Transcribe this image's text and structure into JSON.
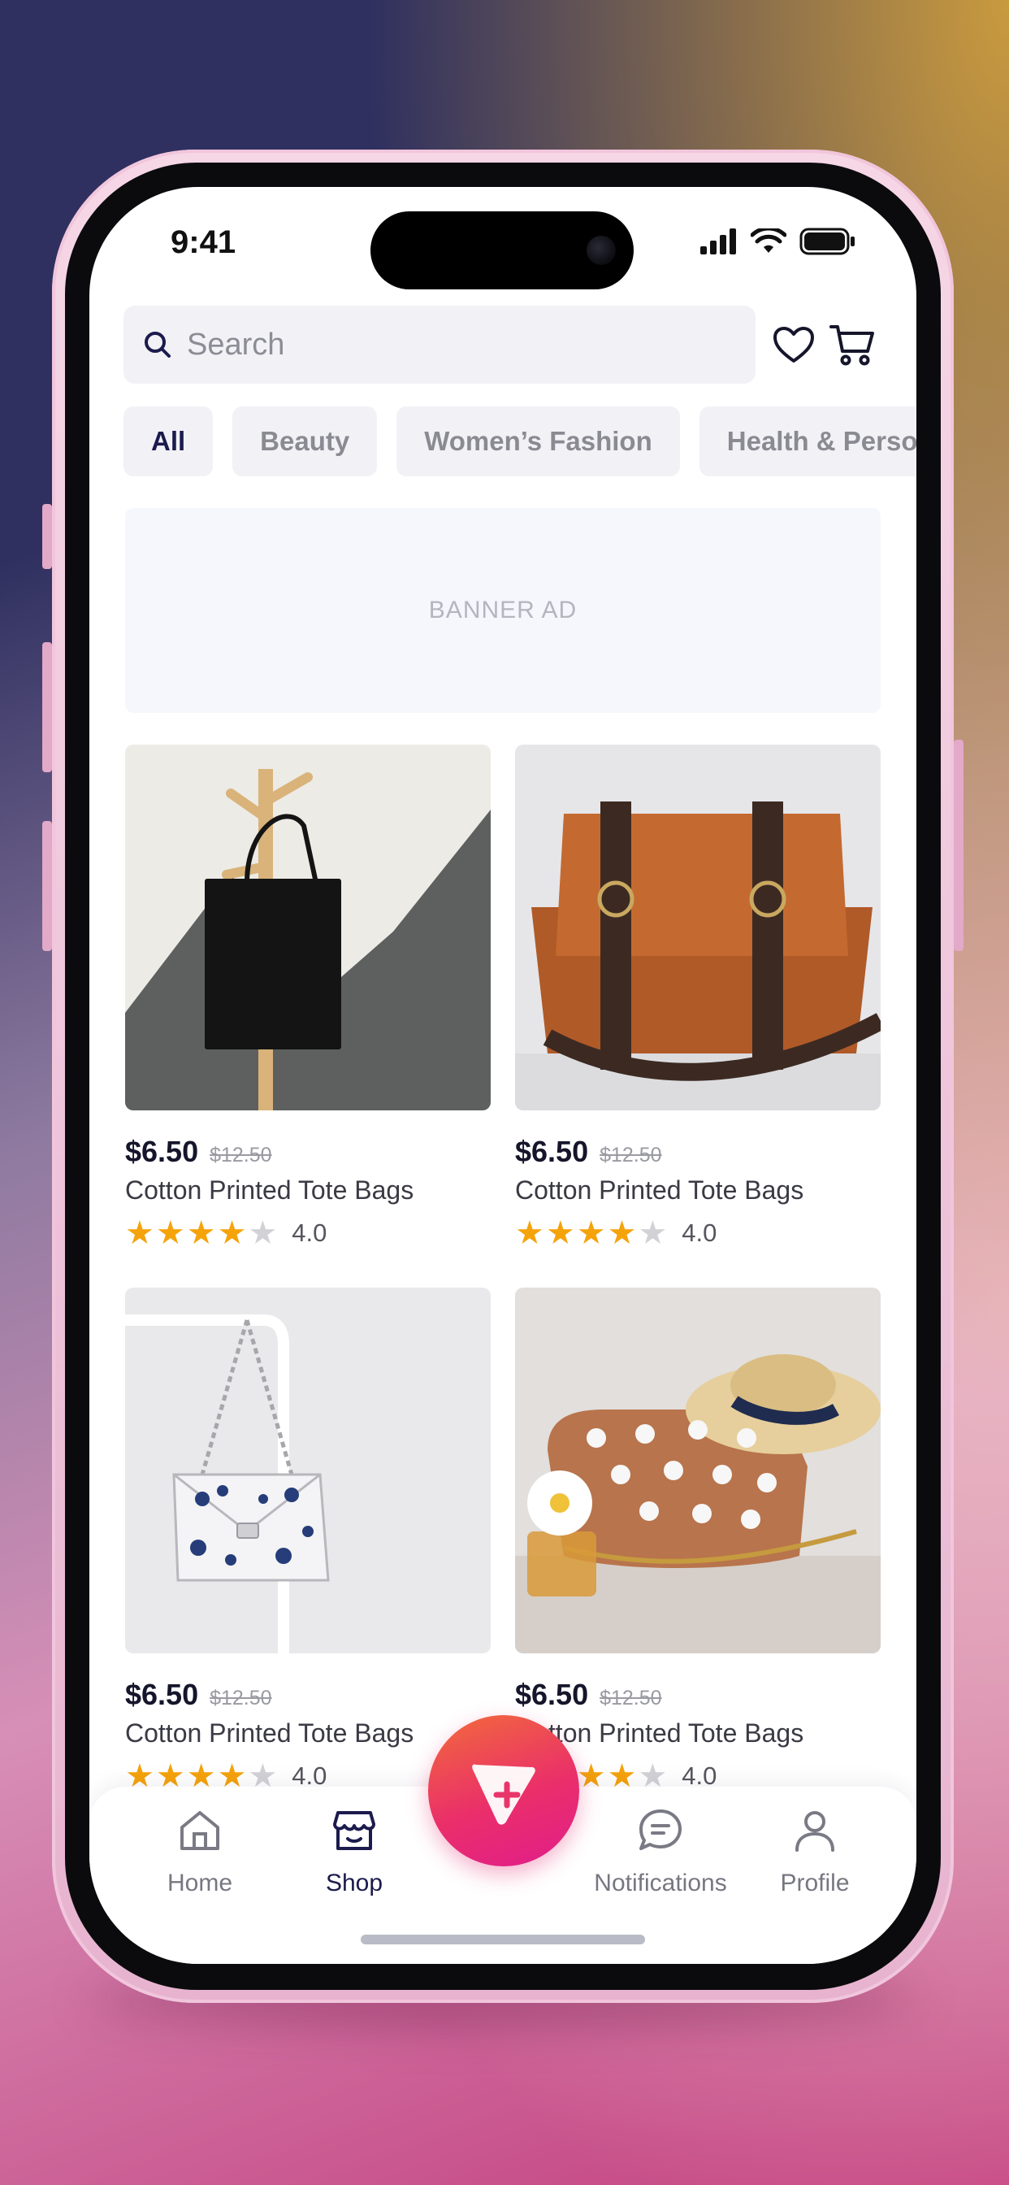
{
  "status_bar": {
    "time": "9:41"
  },
  "header": {
    "search_placeholder": "Search"
  },
  "categories": [
    {
      "label": "All",
      "active": true
    },
    {
      "label": "Beauty",
      "active": false
    },
    {
      "label": "Women’s Fashion",
      "active": false
    },
    {
      "label": "Health & Personal",
      "active": false
    }
  ],
  "banner": {
    "label": "BANNER AD"
  },
  "products": [
    {
      "price": "$6.50",
      "old_price": "$12.50",
      "title": "Cotton Printed Tote Bags",
      "rating": 4,
      "rating_label": "4.0",
      "image": "black-tote-bag-photo"
    },
    {
      "price": "$6.50",
      "old_price": "$12.50",
      "title": "Cotton Printed Tote Bags",
      "rating": 4,
      "rating_label": "4.0",
      "image": "brown-leather-messenger-bag-photo"
    },
    {
      "price": "$6.50",
      "old_price": "$12.50",
      "title": "Cotton Printed Tote Bags",
      "rating": 4,
      "rating_label": "4.0",
      "image": "floral-chain-handbag-photo"
    },
    {
      "price": "$6.50",
      "old_price": "$12.50",
      "title": "Cotton Printed Tote Bags",
      "rating": 4,
      "rating_label": "4.0",
      "image": "flower-studded-bag-with-hat-photo"
    }
  ],
  "bottom_nav": {
    "items": [
      {
        "label": "Home",
        "icon": "home-icon",
        "active": false
      },
      {
        "label": "Shop",
        "icon": "shop-icon",
        "active": true
      },
      {
        "label": "Notifications",
        "icon": "chat-bubble-icon",
        "active": false
      },
      {
        "label": "Profile",
        "icon": "person-icon",
        "active": false
      }
    ],
    "center_action_icon": "triangle-plus-icon"
  },
  "colors": {
    "accent_dark": "#1c1b4d",
    "star": "#f5a30b",
    "fab_gradient_start": "#f26b3a",
    "fab_gradient_end": "#e01d8a"
  }
}
